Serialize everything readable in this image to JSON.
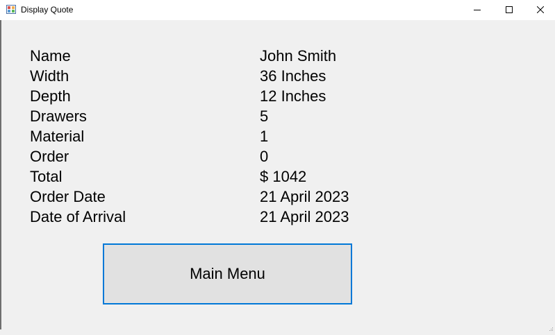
{
  "window": {
    "title": "Display Quote",
    "minimize_icon": "minimize-icon",
    "maximize_icon": "maximize-icon",
    "close_icon": "close-icon",
    "app_icon": "form-app-icon"
  },
  "quote": {
    "fields": [
      {
        "label": "Name",
        "value": "John Smith"
      },
      {
        "label": "Width",
        "value": "36 Inches"
      },
      {
        "label": "Depth",
        "value": "12 Inches"
      },
      {
        "label": "Drawers",
        "value": "5"
      },
      {
        "label": "Material",
        "value": "1"
      },
      {
        "label": "Order",
        "value": "0"
      },
      {
        "label": "Total",
        "value": "$ 1042"
      },
      {
        "label": "Order Date",
        "value": "21 April 2023"
      },
      {
        "label": "Date of Arrival",
        "value": "21 April 2023"
      }
    ]
  },
  "actions": {
    "main_menu_label": "Main Menu"
  },
  "colors": {
    "window_bg": "#f0f0f0",
    "titlebar_bg": "#ffffff",
    "button_bg": "#e1e1e1",
    "button_focus_border": "#0078d7"
  }
}
